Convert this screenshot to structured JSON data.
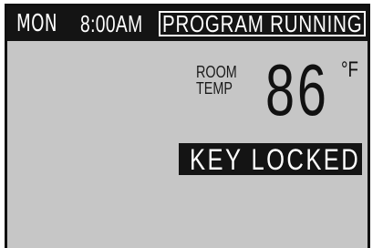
{
  "status_bar": {
    "day": "MON",
    "time": "8:00AM",
    "program_status": "PROGRAM RUNNING"
  },
  "room_temp": {
    "label_line1": "ROOM",
    "label_line2": "TEMP",
    "value": "86",
    "unit": "°F"
  },
  "lock_status": {
    "text": "KEY LOCKED"
  },
  "colors": {
    "screen_background": "#c6c6c6",
    "bar_background": "#141414",
    "text_dark": "#111111",
    "text_light": "#ffffff"
  }
}
